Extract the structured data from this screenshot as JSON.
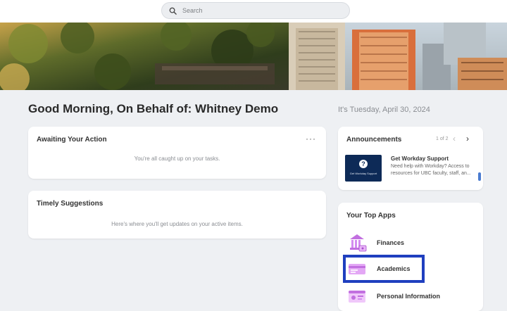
{
  "search": {
    "placeholder": "Search"
  },
  "greeting": "Good Morning, On Behalf of: Whitney Demo",
  "date": "It's Tuesday, April 30, 2024",
  "awaiting": {
    "title": "Awaiting Your Action",
    "more": "···",
    "message": "You're all caught up on your tasks."
  },
  "suggestions": {
    "title": "Timely Suggestions",
    "message": "Here's where you'll get updates on your active items."
  },
  "announcements": {
    "title": "Announcements",
    "pager": "1 of 2",
    "prev": "‹",
    "next": "›",
    "item": {
      "thumb_caption": "Get Workday Support",
      "title": "Get Workday Support",
      "body": "Need help with Workday? Access to resources for UBC faculty, staff, an..."
    }
  },
  "top_apps": {
    "title": "Your Top Apps",
    "apps": [
      {
        "label": "Finances",
        "icon": "bank-icon"
      },
      {
        "label": "Academics",
        "icon": "graduation-card-icon"
      },
      {
        "label": "Personal Information",
        "icon": "id-card-icon"
      }
    ]
  },
  "colors": {
    "accent_icon": "#c26fe0",
    "highlight_border": "#1f3fbf",
    "announcement_thumb": "#0d2a57"
  }
}
